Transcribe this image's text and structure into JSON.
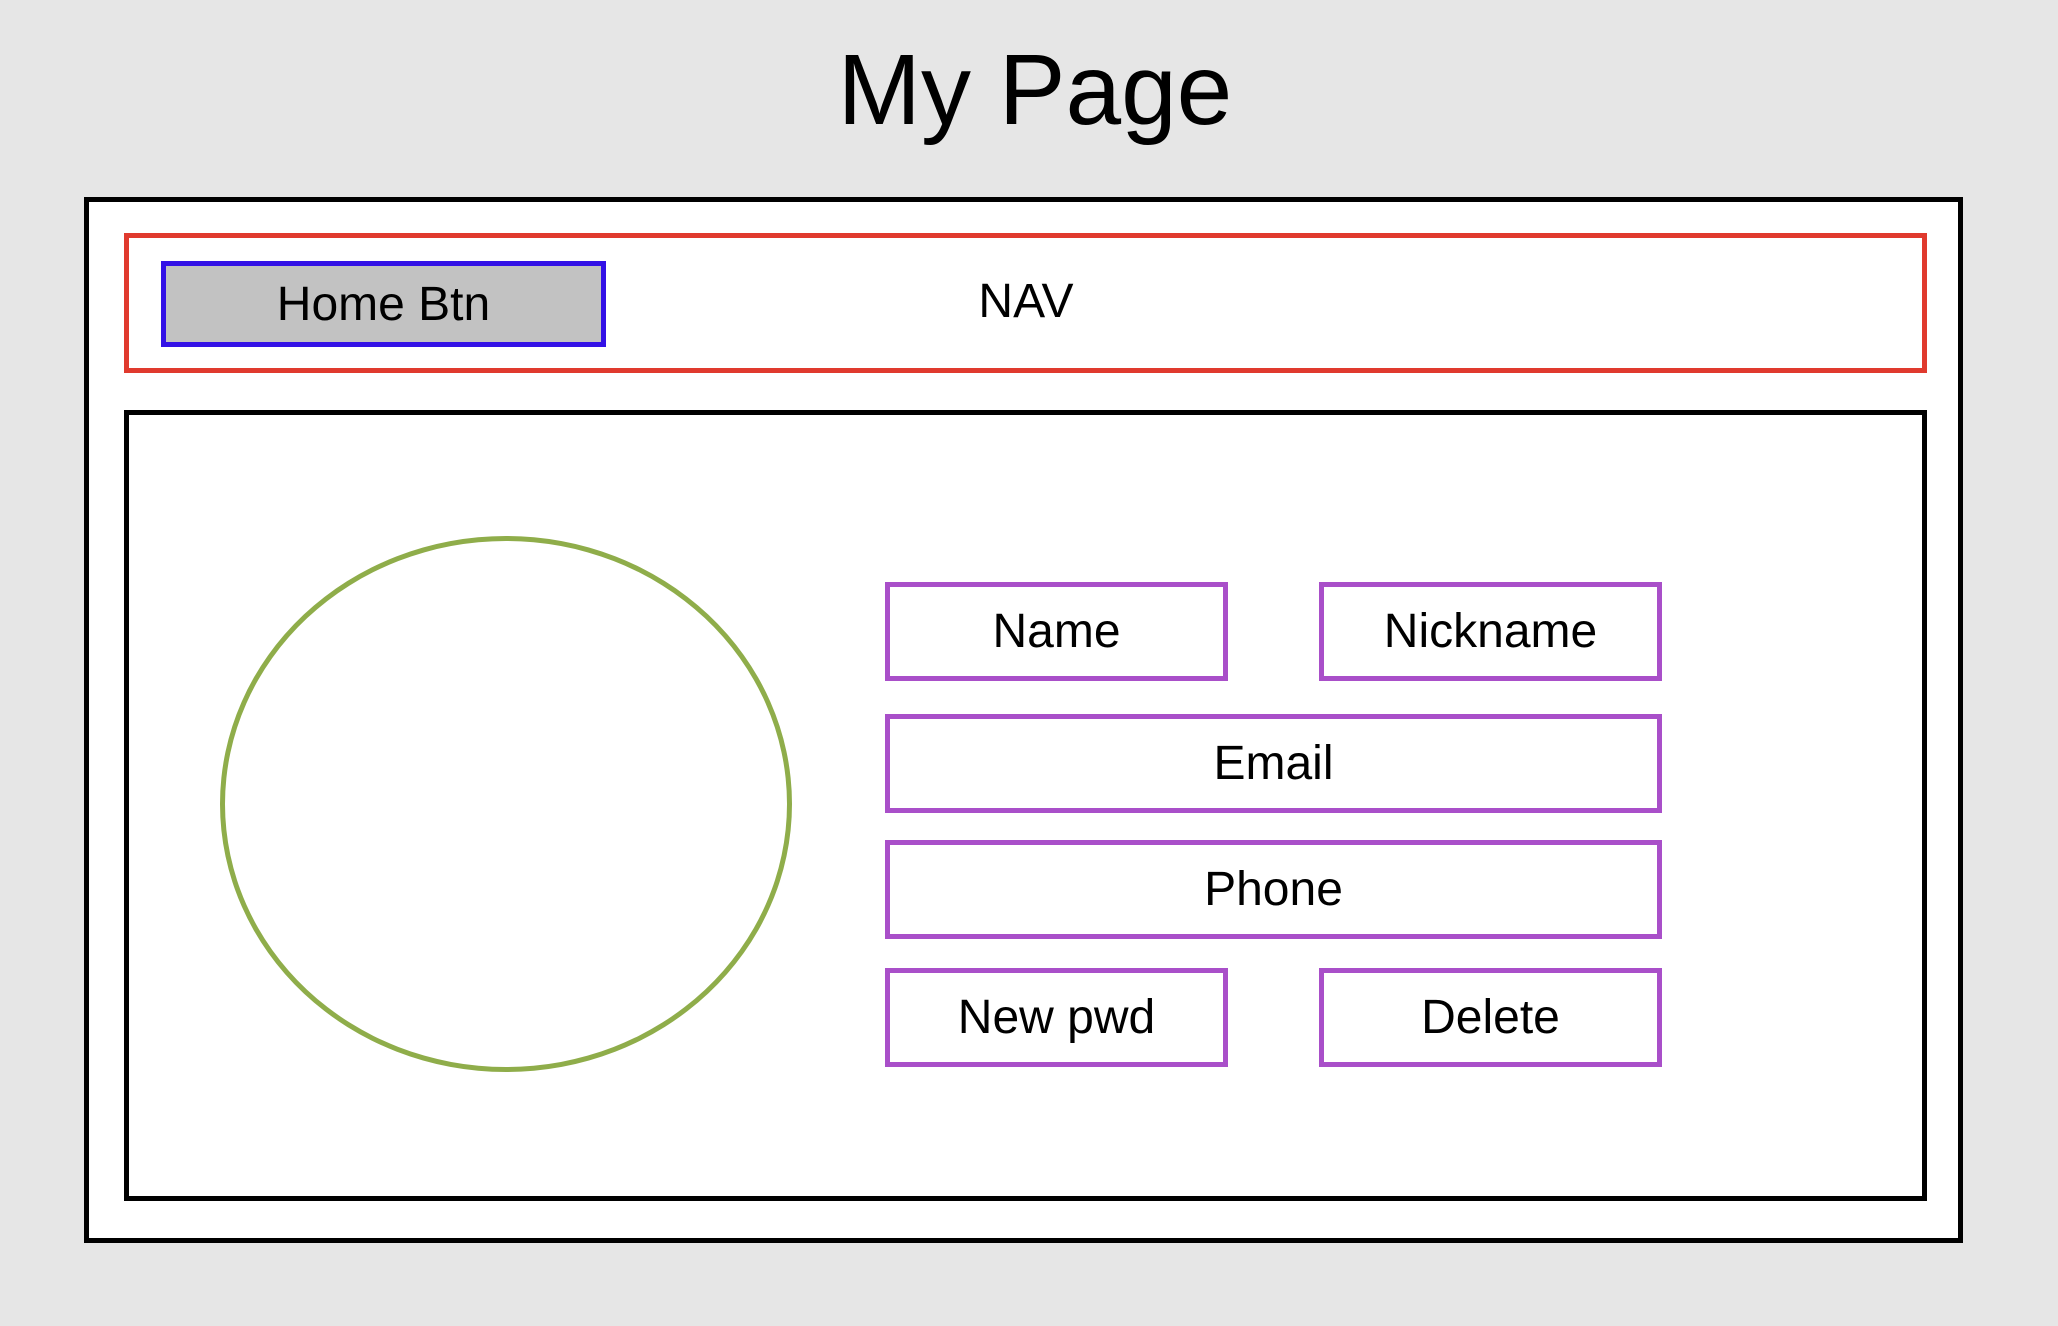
{
  "page": {
    "title": "My Page"
  },
  "nav": {
    "label": "NAV",
    "home_button_label": "Home Btn"
  },
  "profile": {
    "fields": {
      "name": "Name",
      "nickname": "Nickname",
      "email": "Email",
      "phone": "Phone"
    },
    "actions": {
      "new_password": "New pwd",
      "delete": "Delete"
    }
  },
  "colors": {
    "background": "#e6e6e6",
    "nav_border": "#e03a2e",
    "home_button_border": "#3311e6",
    "home_button_fill": "#c2c2c2",
    "avatar_border": "#8fad4a",
    "field_border": "#a94fc9",
    "frame_border": "#000000"
  }
}
